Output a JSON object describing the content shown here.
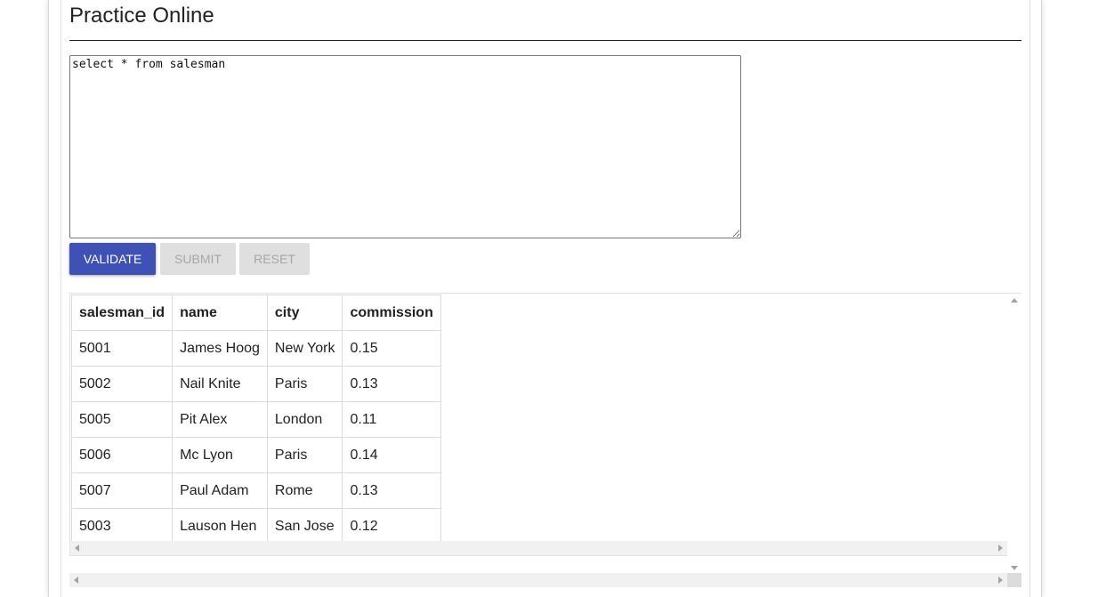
{
  "page": {
    "title": "Practice Online"
  },
  "editor": {
    "value": "select * from salesman"
  },
  "buttons": {
    "validate": "VALIDATE",
    "submit": "SUBMIT",
    "reset": "RESET"
  },
  "colors": {
    "primary": "#3f51b5",
    "disabled_bg": "#dfdfdf",
    "disabled_text": "#a6a6a6"
  },
  "results": {
    "columns": [
      "salesman_id",
      "name",
      "city",
      "commission"
    ],
    "rows": [
      [
        "5001",
        "James Hoog",
        "New York",
        "0.15"
      ],
      [
        "5002",
        "Nail Knite",
        "Paris",
        "0.13"
      ],
      [
        "5005",
        "Pit Alex",
        "London",
        "0.11"
      ],
      [
        "5006",
        "Mc Lyon",
        "Paris",
        "0.14"
      ],
      [
        "5007",
        "Paul Adam",
        "Rome",
        "0.13"
      ],
      [
        "5003",
        "Lauson Hen",
        "San Jose",
        "0.12"
      ]
    ]
  }
}
